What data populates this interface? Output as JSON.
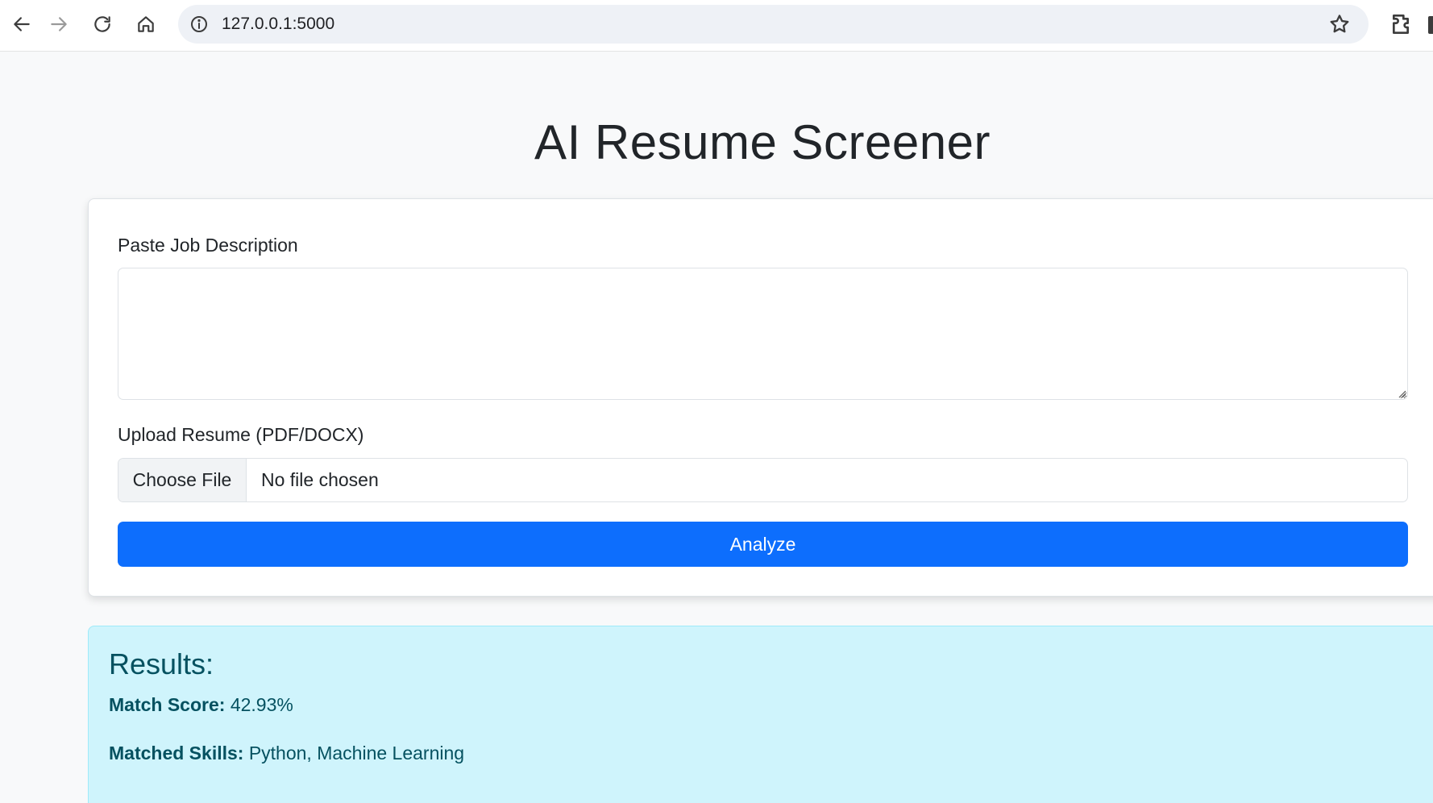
{
  "browser": {
    "url": "127.0.0.1:5000"
  },
  "page": {
    "title": "AI Resume Screener"
  },
  "form": {
    "job_description_label": "Paste Job Description",
    "job_description_value": "",
    "upload_label": "Upload Resume (PDF/DOCX)",
    "choose_file_label": "Choose File",
    "file_status": "No file chosen",
    "analyze_label": "Analyze"
  },
  "results": {
    "title": "Results:",
    "match_score_label": "Match Score:",
    "match_score_value": "42.93%",
    "matched_skills_label": "Matched Skills:",
    "matched_skills_value": "Python, Machine Learning"
  },
  "colors": {
    "primary": "#0d6efd",
    "info_bg": "#cff4fc",
    "info_text": "#055160"
  }
}
